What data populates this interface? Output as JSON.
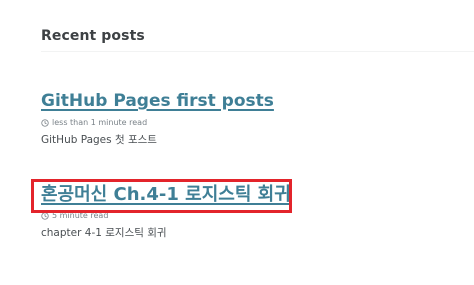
{
  "section": {
    "title": "Recent posts"
  },
  "posts": [
    {
      "title": "GitHub Pages first posts",
      "meta": "less than 1 minute read",
      "excerpt": "GitHub Pages 첫 포스트"
    },
    {
      "title": "혼공머신 Ch.4-1 로지스틱 회귀",
      "meta": "5 minute read",
      "excerpt": "chapter 4-1 로지스틱 회귀"
    }
  ],
  "colors": {
    "link": "#3f7f96",
    "highlight": "#e3242b",
    "meta": "#7a8288"
  },
  "icons": {
    "meta": "clock-icon"
  }
}
